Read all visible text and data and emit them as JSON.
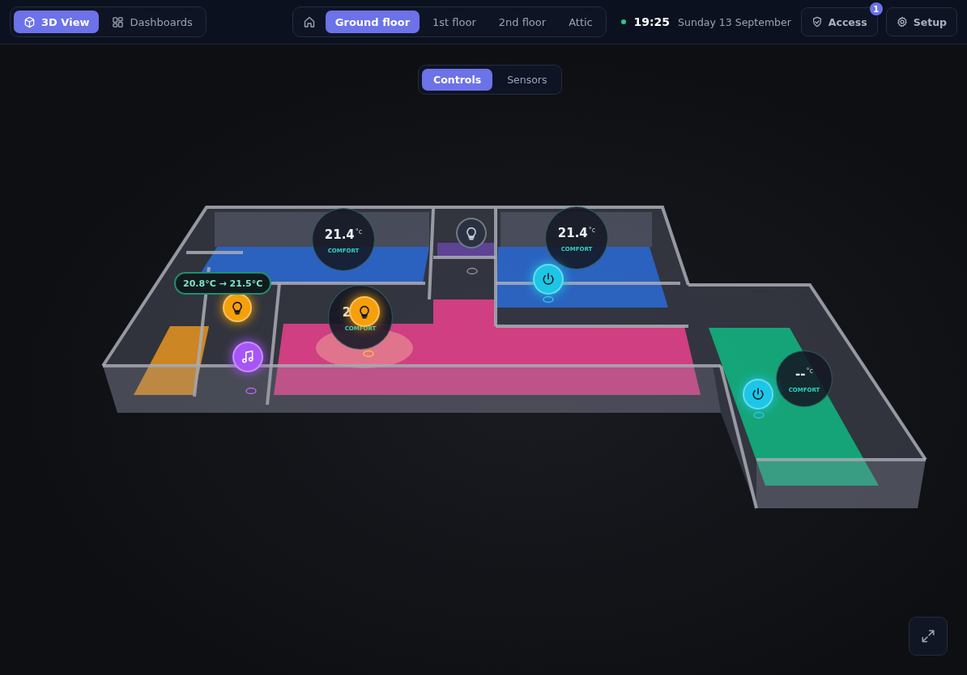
{
  "view_tabs": [
    {
      "label": "3D View",
      "selected": true
    },
    {
      "label": "Dashboards",
      "selected": false
    }
  ],
  "floor_tabs": [
    {
      "label": "Ground floor",
      "selected": true
    },
    {
      "label": "1st floor",
      "selected": false
    },
    {
      "label": "2nd floor",
      "selected": false
    },
    {
      "label": "Attic",
      "selected": false
    }
  ],
  "status": {
    "time": "19:25",
    "date": "Sunday 13 September"
  },
  "header_buttons": [
    {
      "kind": "access",
      "label": "Access",
      "badge": "1"
    },
    {
      "kind": "setup",
      "label": "Setup"
    }
  ],
  "mode_tabs": [
    {
      "label": "Controls",
      "selected": true
    },
    {
      "label": "Sensors",
      "selected": false
    }
  ],
  "thermostats": [
    {
      "reading": "21.4",
      "unit": "°c",
      "mode": "COMFORT"
    },
    {
      "reading": "21.4",
      "unit": "°c",
      "mode": "COMFORT"
    },
    {
      "reading": "2",
      "mode": "COMFORT"
    },
    {
      "reading": "--",
      "unit": "°c",
      "mode": "COMFORT"
    }
  ],
  "tooltip": "20.8°C → 21.5°C",
  "devices": [
    {
      "kind": "light",
      "on": true
    },
    {
      "kind": "light",
      "on": true
    },
    {
      "kind": "light",
      "on": false
    },
    {
      "kind": "music",
      "on": true
    },
    {
      "kind": "power",
      "on": true
    },
    {
      "kind": "power",
      "on": true
    }
  ]
}
